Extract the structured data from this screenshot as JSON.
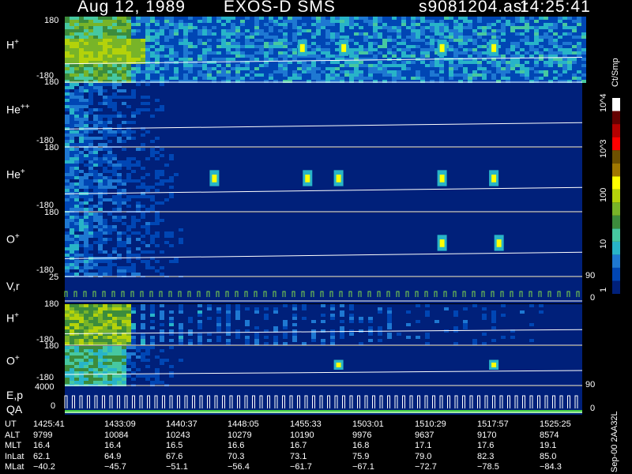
{
  "header": {
    "date": "Aug 12, 1989",
    "instrument": "EXOS-D SMS",
    "file": "s9081204.asr",
    "time": "14:25:41"
  },
  "colors": {
    "background": "#000000",
    "plot_background": "#00207a",
    "trace": "#ffffff",
    "scale": [
      "#00207a",
      "#0046b4",
      "#1e78d2",
      "#28b4c8",
      "#46c8a0",
      "#3c8c3c",
      "#78b428",
      "#b4d20a",
      "#ffff00",
      "#a07800",
      "#6e5000",
      "#ff0000",
      "#b40000",
      "#640000",
      "#ffffff"
    ]
  },
  "colorbar": {
    "unit": "Ct/Smp",
    "scale": "log",
    "labels": [
      "10^4",
      "10^3",
      "100",
      "10",
      "1"
    ]
  },
  "chart_data": [
    {
      "type": "heatmap",
      "panel": "H+",
      "species": "H",
      "charge": "+",
      "ylim": [
        -180,
        180
      ],
      "y_ticks": [
        "180",
        "-180"
      ],
      "trend": "high counts broadly across the pass, strongest at start"
    },
    {
      "type": "heatmap",
      "panel": "He++",
      "species": "He",
      "charge": "++",
      "ylim": [
        -180,
        180
      ],
      "y_ticks": [
        "180",
        "-180"
      ],
      "trend": "counts only in first ~10 minutes"
    },
    {
      "type": "heatmap",
      "panel": "He+",
      "species": "He",
      "charge": "+",
      "ylim": [
        -180,
        180
      ],
      "y_ticks": [
        "180",
        "-180"
      ],
      "trend": "early counts plus isolated bursts near 1452, 1457, 1510, 1515"
    },
    {
      "type": "heatmap",
      "panel": "O+",
      "species": "O",
      "charge": "+",
      "ylim": [
        -180,
        180
      ],
      "y_ticks": [
        "180",
        "-180"
      ],
      "trend": "counts in first ~10 minutes, small burst near 1510"
    },
    {
      "type": "line",
      "panel": "V,r",
      "label": "V,r",
      "ylim_left": [
        0,
        25
      ],
      "left_ticks": [
        "25"
      ],
      "right_ticks": [
        "90",
        "0"
      ]
    },
    {
      "type": "heatmap",
      "panel": "H+ (2)",
      "species": "H",
      "charge": "+",
      "ylim": [
        -180,
        180
      ],
      "y_ticks": [
        "180",
        "-180"
      ],
      "trend": "periodic vertical stripes through ~1510"
    },
    {
      "type": "heatmap",
      "panel": "O+ (2)",
      "species": "O",
      "charge": "+",
      "ylim": [
        -180,
        180
      ],
      "y_ticks": [
        "180",
        "-180"
      ],
      "trend": "counts in first ~10 minutes, faint bursts later"
    },
    {
      "type": "line",
      "panel": "E,p",
      "label": "E,p",
      "label2": "QA",
      "ylim_left": [
        0,
        4000
      ],
      "left_ticks": [
        "4000",
        "0"
      ],
      "right_ticks": [
        "90",
        "0"
      ]
    }
  ],
  "ephemeris": {
    "row_labels": [
      "UT",
      "ALT",
      "MLT",
      "InLat",
      "MLat"
    ],
    "columns": [
      {
        "UT": "1425:41",
        "ALT": "9799",
        "MLT": "16.4",
        "InLat": "62.1",
        "MLat": "−40.2"
      },
      {
        "UT": "1433:09",
        "ALT": "10084",
        "MLT": "16.4",
        "InLat": "64.9",
        "MLat": "−45.7"
      },
      {
        "UT": "1440:37",
        "ALT": "10243",
        "MLT": "16.5",
        "InLat": "67.6",
        "MLat": "−51.1"
      },
      {
        "UT": "1448:05",
        "ALT": "10279",
        "MLT": "16.6",
        "InLat": "70.3",
        "MLat": "−56.4"
      },
      {
        "UT": "1455:33",
        "ALT": "10190",
        "MLT": "16.7",
        "InLat": "73.1",
        "MLat": "−61.7"
      },
      {
        "UT": "1503:01",
        "ALT": "9976",
        "MLT": "16.8",
        "InLat": "75.9",
        "MLat": "−67.1"
      },
      {
        "UT": "1510:29",
        "ALT": "9637",
        "MLT": "17.1",
        "InLat": "79.0",
        "MLat": "−72.7"
      },
      {
        "UT": "1517:57",
        "ALT": "9170",
        "MLT": "17.6",
        "InLat": "82.3",
        "MLat": "−78.5"
      },
      {
        "UT": "1525:25",
        "ALT": "8574",
        "MLT": "19.1",
        "InLat": "85.0",
        "MLat": "−84.3"
      }
    ]
  },
  "footer_tag": "Sep-00  2AA32L"
}
